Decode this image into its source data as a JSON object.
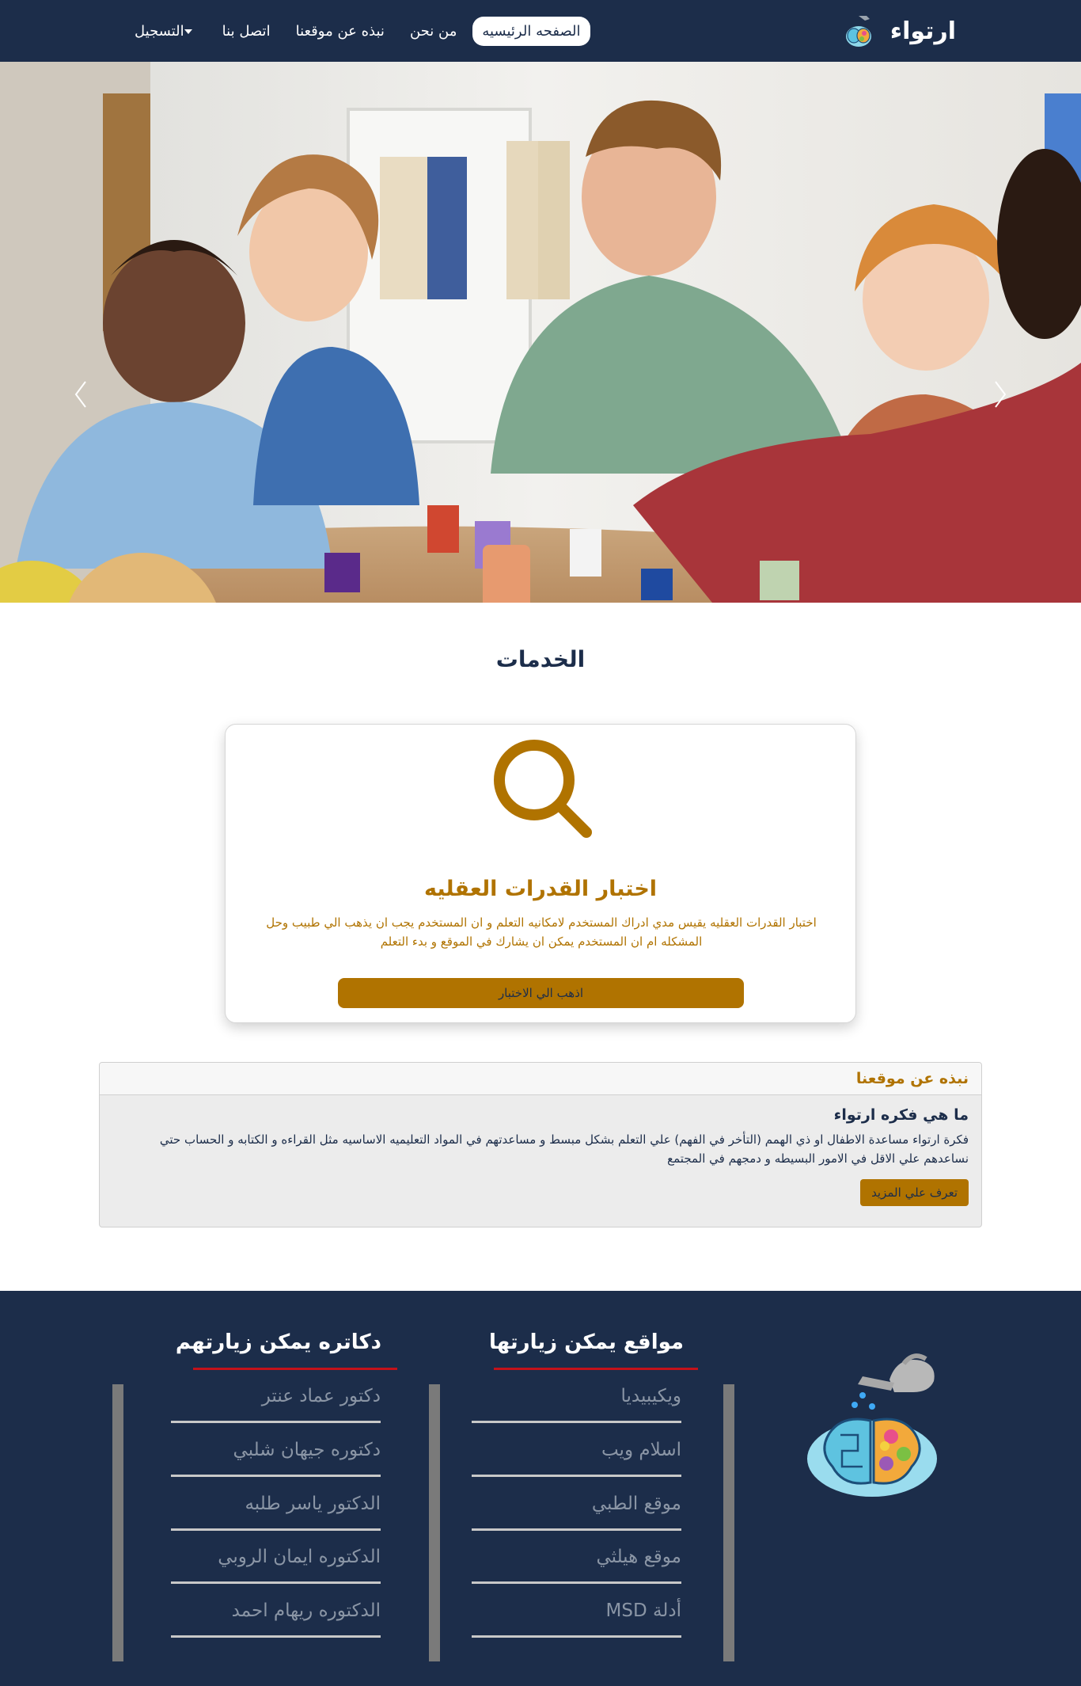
{
  "navbar": {
    "brand": "ارتواء",
    "links": [
      {
        "label": "الصفحه الرئيسيه",
        "active": true
      },
      {
        "label": "من نحن"
      },
      {
        "label": "نبذه عن موقعنا"
      },
      {
        "label": "اتصل بنا"
      },
      {
        "label": "التسجيل",
        "dropdown": true
      }
    ]
  },
  "services": {
    "title": "الخدمات",
    "card": {
      "icon": "search-icon",
      "title": "اختبار القدرات العقليه",
      "text": "اختبار القدرات العقليه يقيس مدي ادراك المستخدم لامكانيه التعلم و ان المستخدم يجب ان يذهب الي طبيب وحل المشكله ام ان المستخدم يمكن ان يشارك في الموقع و بدء التعلم",
      "button": "اذهب الي الاختبار"
    }
  },
  "about": {
    "header": "نبذه عن موقعنا",
    "subtitle": "ما هي فكره ارتواء",
    "text": "فكرة ارتواء مساعدة الاطفال او ذي الهمم (التأخر في الفهم) علي التعلم بشكل مبسط و مساعدتهم في المواد التعليميه الاساسيه مثل القراءه و الكتابه و الحساب حتي نساعدهم علي الاقل في الامور البسيطه و دمجهم في المجتمع",
    "button": "تعرف علي المزيد"
  },
  "footer": {
    "sites": {
      "title": "مواقع يمكن زيارتها",
      "links": [
        "ويكيبيديا",
        "اسلام ويب",
        "موقع الطبي",
        "موقع هيلثي",
        "أدلة MSD"
      ]
    },
    "doctors": {
      "title": "دكاتره يمكن زيارتهم",
      "links": [
        "دكتور عماد عنتر",
        "دكتوره جيهان شلبي",
        "الدكتور ياسر طلبه",
        "الدكتوره ايمان الروبي",
        "الدكتوره ريهام احمد"
      ]
    }
  },
  "colors": {
    "navy": "#1c2d4a",
    "gold": "#b07300",
    "red_accent": "#c4121a"
  },
  "icons": [
    "brain-watering-logo",
    "search-icon",
    "chevron-left-icon",
    "chevron-right-icon",
    "caret-down-icon"
  ]
}
